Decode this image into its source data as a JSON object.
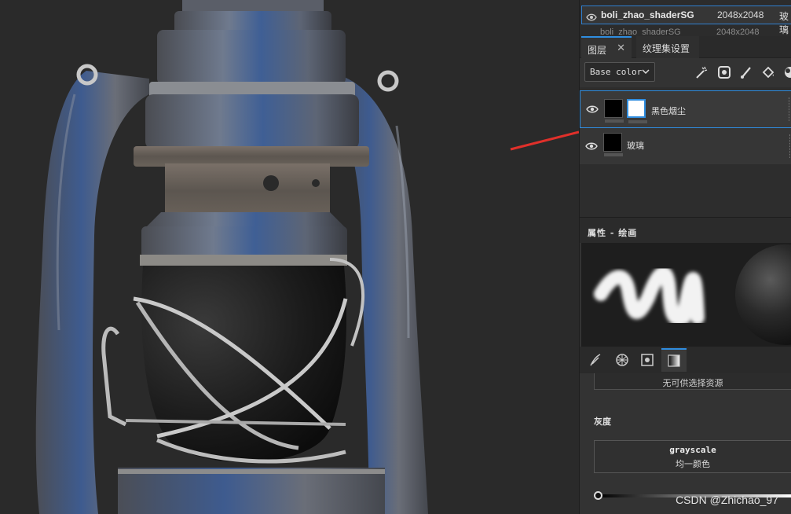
{
  "texture_sets": {
    "selected": {
      "name": "boli_zhao_shaderSG",
      "resolution": "2048x2048",
      "extra": "玻璃"
    },
    "next_partial": {
      "name": "boli_zhao_shaderSG",
      "resolution": "2048x2048"
    }
  },
  "tabs": [
    {
      "label": "图层",
      "close": "✕"
    },
    {
      "label": "纹理集设置"
    }
  ],
  "toolbar": {
    "channel_dropdown": "Base color"
  },
  "layers": [
    {
      "name": "黑色烟尘",
      "visible": true,
      "selected": true
    },
    {
      "name": "玻璃",
      "visible": true,
      "selected": false
    }
  ],
  "properties": {
    "header": "属性 - 绘画",
    "resource_button": "无可供选择资源",
    "section_title": "灰度",
    "source_name": "grayscale",
    "source_sub": "均一颜色"
  },
  "watermark": "CSDN @Zhichao_97",
  "colors": {
    "accent": "#2f8ddf",
    "annotation_arrow": "#e0302a",
    "panel_bg": "#333333",
    "viewport_bg": "#2a2a2a"
  }
}
